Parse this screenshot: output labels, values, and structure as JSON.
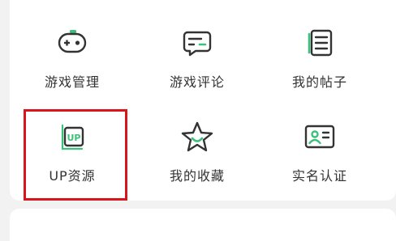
{
  "menu": {
    "items": [
      {
        "label": "游戏管理",
        "icon": "gamepad-icon"
      },
      {
        "label": "游戏评论",
        "icon": "comment-icon"
      },
      {
        "label": "我的帖子",
        "icon": "document-list-icon"
      },
      {
        "label": "UP资源",
        "icon": "up-resource-icon",
        "icon_text": "UP"
      },
      {
        "label": "我的收藏",
        "icon": "star-smile-icon"
      },
      {
        "label": "实名认证",
        "icon": "id-card-icon"
      }
    ]
  },
  "colors": {
    "accent": "#3cc07a",
    "icon_stroke": "#333333",
    "highlight": "#d9141b",
    "background": "#f2f2f2"
  }
}
